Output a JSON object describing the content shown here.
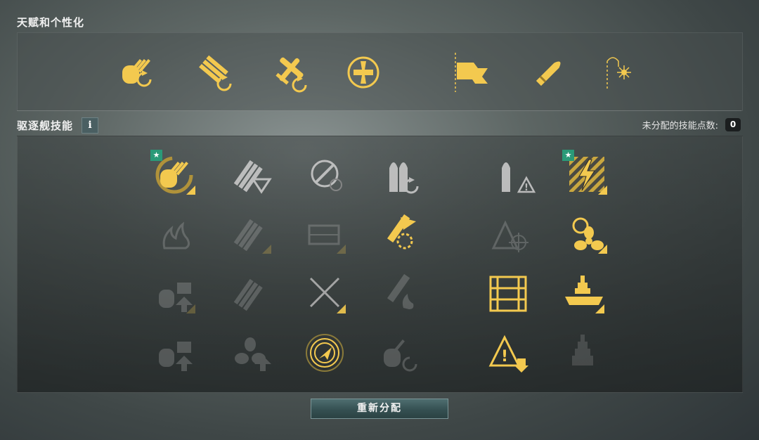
{
  "talents": {
    "title": "天赋和个性化",
    "icons": [
      "gun-reload-icon",
      "torpedo-reload-icon",
      "aircraft-reload-icon",
      "cross-emblem-icon",
      "flag-icon",
      "shell-icon",
      "fuse-spark-icon"
    ]
  },
  "skills": {
    "title": "驱逐舰技能",
    "info": "i",
    "points_label": "未分配的技能点数:",
    "points": "0",
    "colors": {
      "gold": "#f3c94f",
      "gray": "#c8c8c8",
      "dark": "#8a8a8a"
    }
  },
  "reset_label": "重新分配"
}
